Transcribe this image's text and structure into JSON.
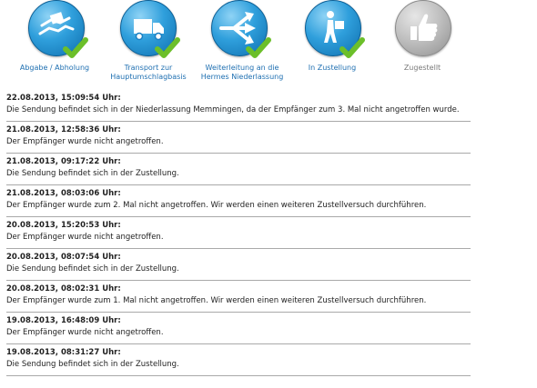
{
  "steps": [
    {
      "label": "Abgabe / Abholung",
      "icon": "parcel-hands-icon",
      "done": true
    },
    {
      "label": "Transport zur Hauptumschlagbasis",
      "icon": "truck-icon",
      "done": true
    },
    {
      "label": "Weiterleitung an die Hermes Niederlassung",
      "icon": "route-arrows-icon",
      "done": true
    },
    {
      "label": "In Zustellung",
      "icon": "courier-icon",
      "done": true
    },
    {
      "label": "Zugestellt",
      "icon": "thumbs-up-icon",
      "done": false
    }
  ],
  "colors": {
    "active_label": "#1e6fb1",
    "inactive_label": "#7a7a7a",
    "check": "#6cbf2a"
  },
  "entries": [
    {
      "ts": "22.08.2013, 15:09:54 Uhr:",
      "msg": "Die Sendung befindet sich in der Niederlassung Memmingen, da der Empfänger zum 3. Mal nicht angetroffen wurde."
    },
    {
      "ts": "21.08.2013, 12:58:36 Uhr:",
      "msg": "Der Empfänger wurde nicht angetroffen."
    },
    {
      "ts": "21.08.2013, 09:17:22 Uhr:",
      "msg": "Die Sendung befindet sich in der Zustellung."
    },
    {
      "ts": "21.08.2013, 08:03:06 Uhr:",
      "msg": "Der Empfänger wurde zum 2. Mal nicht angetroffen. Wir werden einen weiteren Zustellversuch durchführen."
    },
    {
      "ts": "20.08.2013, 15:20:53 Uhr:",
      "msg": "Der Empfänger wurde nicht angetroffen."
    },
    {
      "ts": "20.08.2013, 08:07:54 Uhr:",
      "msg": "Die Sendung befindet sich in der Zustellung."
    },
    {
      "ts": "20.08.2013, 08:02:31 Uhr:",
      "msg": "Der Empfänger wurde zum 1. Mal nicht angetroffen. Wir werden einen weiteren Zustellversuch durchführen."
    },
    {
      "ts": "19.08.2013, 16:48:09 Uhr:",
      "msg": "Der Empfänger wurde nicht angetroffen."
    },
    {
      "ts": "19.08.2013, 08:31:27 Uhr:",
      "msg": "Die Sendung befindet sich in der Zustellung."
    }
  ]
}
